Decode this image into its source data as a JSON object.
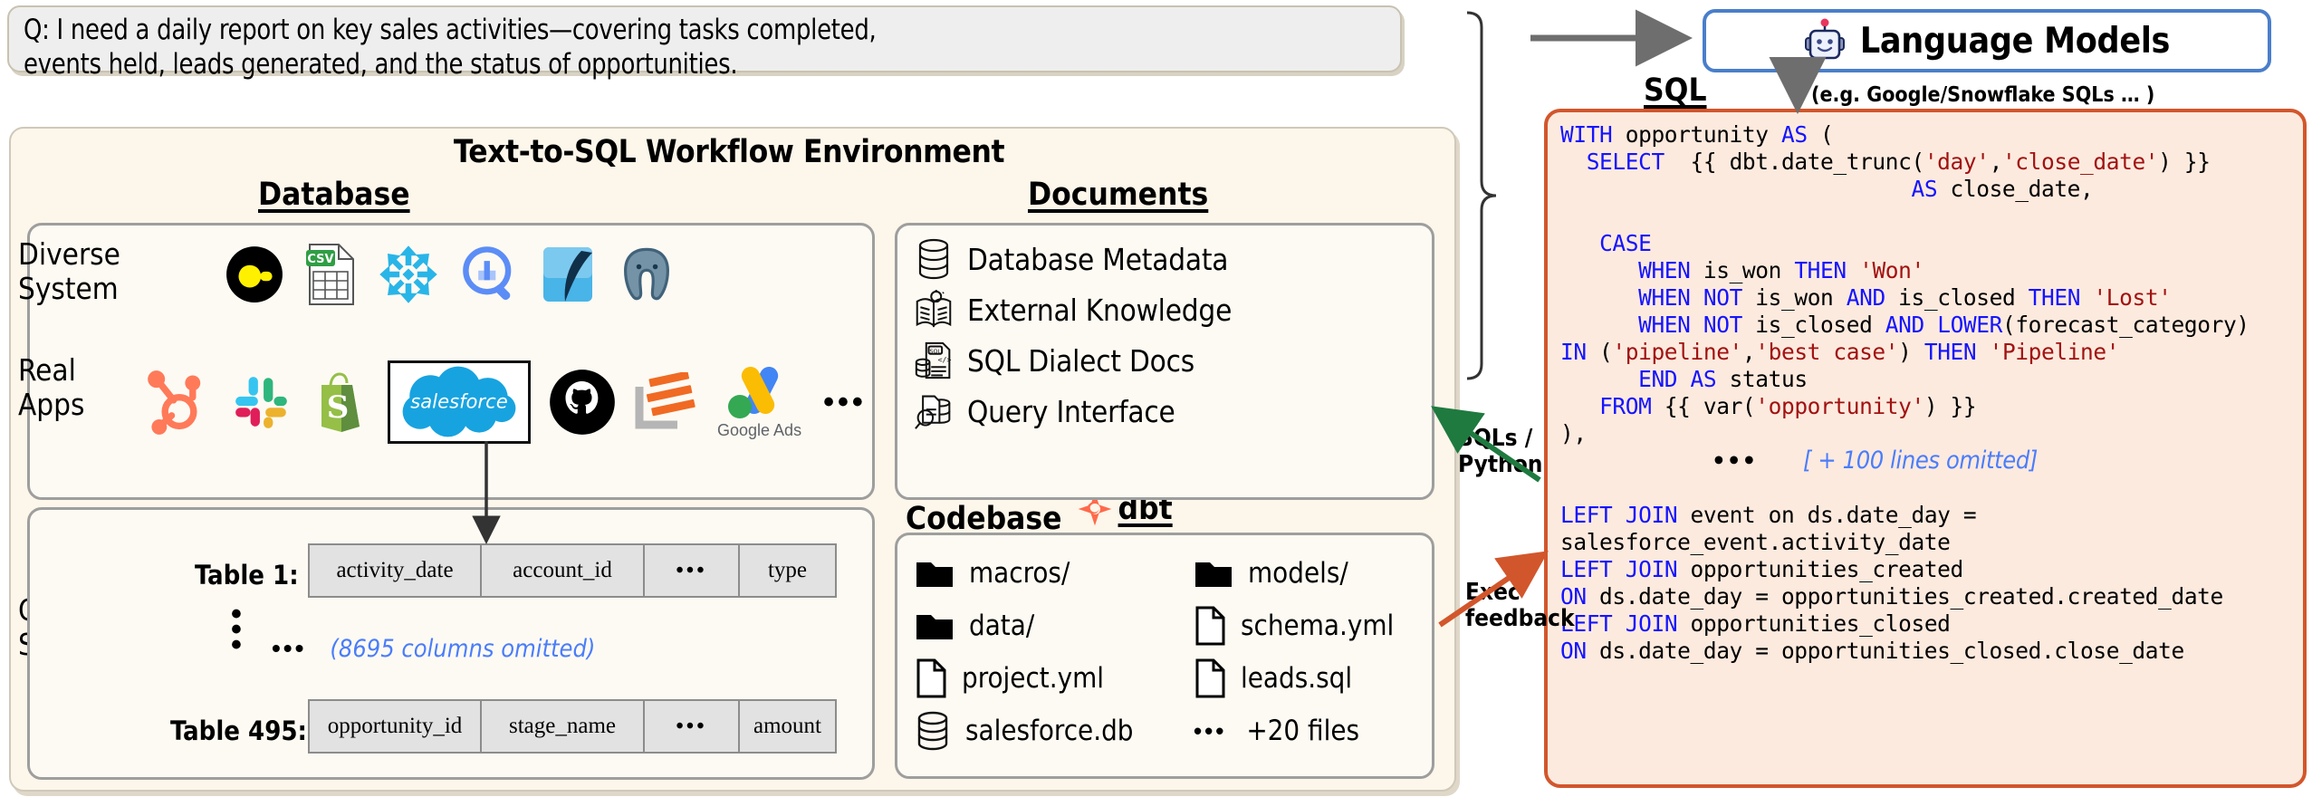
{
  "question": {
    "prefix": "Q:",
    "line1": "I need a daily report on key sales activities—covering tasks completed,",
    "line2": "events held, leads generated, and the status of opportunities."
  },
  "environment": {
    "title": "Text-to-SQL Workflow Environment",
    "database_heading": "Database",
    "documents_heading": "Documents",
    "codebase_heading": "Codebase",
    "codebase_brand": "dbt",
    "rows": {
      "diverse_system": "Diverse\nSystem",
      "diverse_system_l1": "Diverse",
      "diverse_system_l2": "System",
      "real_apps_l1": "Real",
      "real_apps_l2": "Apps",
      "complex_schema_l1": "Complex",
      "complex_schema_l2": "Schema"
    },
    "system_icons": [
      "duckdb-icon",
      "csv-file-icon",
      "snowflake-icon",
      "bigquery-icon",
      "databricks-icon",
      "postgresql-icon"
    ],
    "app_icons": [
      "hubspot-icon",
      "slack-icon",
      "shopify-icon",
      "salesforce-icon",
      "github-icon",
      "asana-icon",
      "google-ads-icon",
      "ellipsis-icon"
    ],
    "app_icon_labels": {
      "salesforce": "salesforce",
      "google_ads": "Google Ads"
    },
    "schema": {
      "table1_label": "Table 1:",
      "table1_columns": [
        "activity_date",
        "account_id",
        "•••",
        "type"
      ],
      "table495_label": "Table 495:",
      "table495_columns": [
        "opportunity_id",
        "stage_name",
        "•••",
        "amount"
      ],
      "omitted_dots": "•••",
      "omitted_text": "(8695 columns omitted)",
      "vertical_dots": "⋮"
    },
    "documents": [
      {
        "icon": "database-icon",
        "label": "Database Metadata"
      },
      {
        "icon": "open-book-bulb-icon",
        "label": "External Knowledge"
      },
      {
        "icon": "sql-doc-icon",
        "label": "SQL Dialect Docs"
      },
      {
        "icon": "query-magnifier-icon",
        "label": "Query Interface"
      }
    ],
    "codebase_files": [
      {
        "icon": "folder-icon",
        "label": "macros/"
      },
      {
        "icon": "folder-icon",
        "label": "models/"
      },
      {
        "icon": "folder-icon",
        "label": "data/"
      },
      {
        "icon": "file-icon",
        "label": "schema.yml"
      },
      {
        "icon": "file-icon",
        "label": "project.yml"
      },
      {
        "icon": "file-icon",
        "label": "leads.sql"
      },
      {
        "icon": "database-icon",
        "label": "salesforce.db"
      },
      {
        "icon": "ellipsis-icon",
        "label": "+20 files"
      }
    ]
  },
  "llm": {
    "label": "Language Models",
    "icon": "robot-icon"
  },
  "sql": {
    "heading": "SQL",
    "dialect_note": "(e.g. Google/Snowflake SQLs … )",
    "omitted_dots": "•••",
    "omitted_note": "[ + 100 lines omitted]",
    "code_lines": [
      "WITH opportunity AS (",
      "  SELECT  {{ dbt.date_trunc('day','close_date') }}",
      "                           AS close_date,",
      "",
      "   CASE",
      "      WHEN is_won THEN 'Won'",
      "      WHEN NOT is_won AND is_closed THEN 'Lost'",
      "      WHEN NOT is_closed AND LOWER(forecast_category)",
      "IN ('pipeline','best case') THEN 'Pipeline'",
      "      END AS status",
      "   FROM {{ var('opportunity') }}",
      "),",
      "",
      "LEFT JOIN event on ds.date_day =",
      "salesforce_event.activity_date",
      "LEFT JOIN opportunities_created",
      "ON ds.date_day = opportunities_created.created_date",
      "LEFT JOIN opportunities_closed",
      "ON ds.date_day = opportunities_closed.close_date"
    ]
  },
  "feedback": {
    "sqls_python_l1": "SQLs /",
    "sqls_python_l2": "Python",
    "exec_l1": "Exec",
    "exec_l2": "feedback"
  },
  "colors": {
    "panel_bg": "#fdf6ea",
    "question_bg": "#eeeeee",
    "sql_bg": "#fdeade",
    "sql_border": "#d2562c",
    "llm_border": "#4a7ecb",
    "accent_blue": "#4a7dfb",
    "keyword_blue": "#1414ff",
    "string_red": "#a11212",
    "arrow_green": "#1f7a3f",
    "arrow_orange": "#d2562c"
  }
}
